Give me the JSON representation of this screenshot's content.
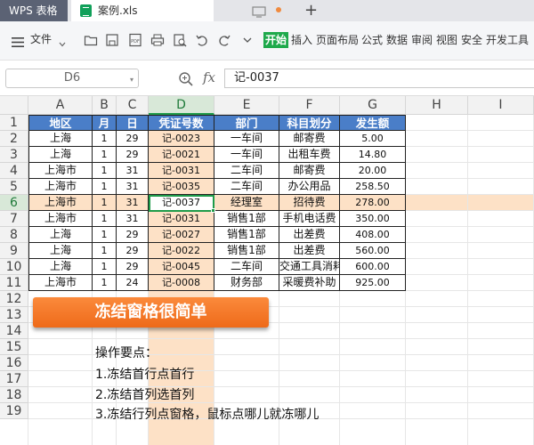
{
  "app": {
    "title": "WPS 表格"
  },
  "file_tab": {
    "name": "案例.xls"
  },
  "toolbar": {
    "file_menu": "文件",
    "tabs": [
      "开始",
      "插入",
      "页面布局",
      "公式",
      "数据",
      "审阅",
      "视图",
      "安全",
      "开发工具"
    ]
  },
  "formula_bar": {
    "cell_ref": "D6",
    "fx": "fx",
    "value": "记-0037"
  },
  "columns": [
    "A",
    "B",
    "C",
    "D",
    "E",
    "F",
    "G",
    "H",
    "I"
  ],
  "rows": [
    "1",
    "2",
    "3",
    "4",
    "5",
    "6",
    "7",
    "8",
    "9",
    "10",
    "11",
    "12",
    "13",
    "14",
    "15",
    "16",
    "17",
    "18",
    "19"
  ],
  "table": {
    "headers": [
      "地区",
      "月",
      "日",
      "凭证号数",
      "部门",
      "科目划分",
      "发生额"
    ],
    "data": [
      [
        "上海",
        "1",
        "29",
        "记-0023",
        "一车间",
        "邮寄费",
        "5.00"
      ],
      [
        "上海",
        "1",
        "29",
        "记-0021",
        "一车间",
        "出租车费",
        "14.80"
      ],
      [
        "上海市",
        "1",
        "31",
        "记-0031",
        "二车间",
        "邮寄费",
        "20.00"
      ],
      [
        "上海市",
        "1",
        "31",
        "记-0035",
        "二车间",
        "办公用品",
        "258.50"
      ],
      [
        "上海市",
        "1",
        "31",
        "记-0037",
        "经理室",
        "招待费",
        "278.00"
      ],
      [
        "上海市",
        "1",
        "31",
        "记-0031",
        "销售1部",
        "手机电话费",
        "350.00"
      ],
      [
        "上海",
        "1",
        "29",
        "记-0027",
        "销售1部",
        "出差费",
        "408.00"
      ],
      [
        "上海",
        "1",
        "29",
        "记-0022",
        "销售1部",
        "出差费",
        "560.00"
      ],
      [
        "上海",
        "1",
        "29",
        "记-0045",
        "二车间",
        "交通工具消耗",
        "600.00"
      ],
      [
        "上海市",
        "1",
        "24",
        "记-0008",
        "财务部",
        "采暖费补助",
        "925.00"
      ]
    ]
  },
  "banner": {
    "text": "冻结窗格很简单"
  },
  "notes": {
    "heading": "操作要点：",
    "items": [
      "1.冻结首行点首行",
      "2.冻结首列选首列",
      "3.冻结行列点窗格，鼠标点哪儿就冻哪儿"
    ]
  },
  "colors": {
    "accent": "#1ea94b",
    "header_fill": "#4a7ec8",
    "highlight": "#fde1c6",
    "banner": "#f47a28"
  }
}
